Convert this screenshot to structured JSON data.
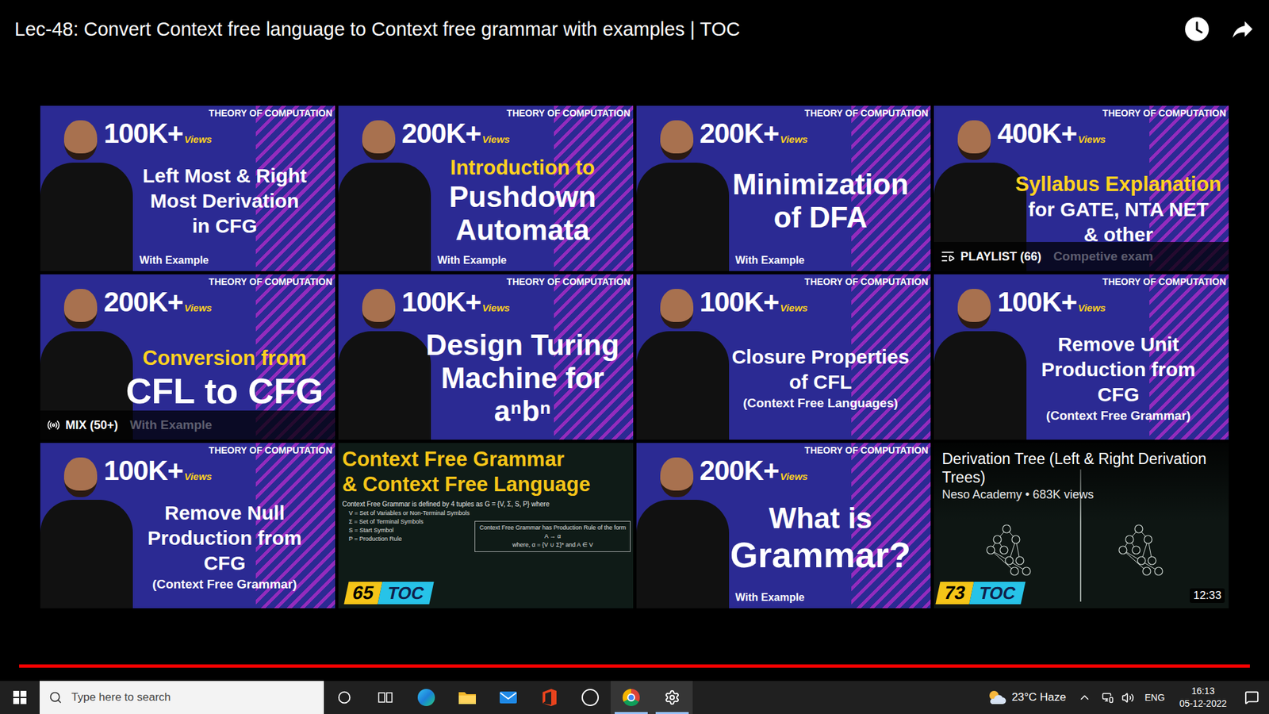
{
  "player": {
    "title": "Lec-48: Convert Context free language to Context free grammar with examples | TOC"
  },
  "progress": {
    "level": 1
  },
  "videos": [
    {
      "kind": "channel",
      "banner": "THEORY OF COMPUTATION",
      "views": "100K+",
      "views_label": "Views",
      "lines": [
        {
          "text": "Left Most & Right",
          "kind": "normal",
          "color": "#ffffff"
        },
        {
          "text": "Most Derivation",
          "kind": "normal",
          "color": "#ffffff"
        },
        {
          "text": "in CFG",
          "kind": "normal",
          "color": "#ffffff"
        }
      ],
      "footer": "With Example"
    },
    {
      "kind": "channel",
      "banner": "THEORY OF COMPUTATION",
      "views": "200K+",
      "views_label": "Views",
      "lines": [
        {
          "text": "Introduction to",
          "kind": "accent",
          "color": "#ffd21f"
        },
        {
          "text": "Pushdown",
          "kind": "big",
          "color": "#ffffff"
        },
        {
          "text": "Automata",
          "kind": "big",
          "color": "#ffffff"
        }
      ],
      "footer": "With Example"
    },
    {
      "kind": "channel",
      "banner": "THEORY OF COMPUTATION",
      "views": "200K+",
      "views_label": "Views",
      "lines": [
        {
          "text": "Minimization",
          "kind": "big",
          "color": "#ffffff"
        },
        {
          "text": "of DFA",
          "kind": "big",
          "color": "#ffffff"
        }
      ],
      "footer": "With Example"
    },
    {
      "kind": "channel",
      "banner": "THEORY OF COMPUTATION",
      "views": "400K+",
      "views_label": "Views",
      "lines": [
        {
          "text": "Syllabus Explanation",
          "kind": "accent",
          "color": "#ffd21f"
        },
        {
          "text": "for GATE, NTA NET",
          "kind": "normal",
          "color": "#ffffff"
        },
        {
          "text": "& other",
          "kind": "normal",
          "color": "#ffffff"
        }
      ],
      "overlay": {
        "kind": "playlist",
        "label": "PLAYLIST (66)",
        "faded": "Competive exam"
      }
    },
    {
      "kind": "channel",
      "banner": "THEORY OF COMPUTATION",
      "views": "200K+",
      "views_label": "Views",
      "lines": [
        {
          "text": "Conversion from",
          "kind": "accent",
          "color": "#ffd21f"
        },
        {
          "text": "CFL to CFG",
          "kind": "huge",
          "color": "#ffffff"
        }
      ],
      "overlay": {
        "kind": "mix",
        "label": "MIX (50+)",
        "faded": "With Example"
      }
    },
    {
      "kind": "channel",
      "banner": "THEORY OF COMPUTATION",
      "views": "100K+",
      "views_label": "Views",
      "lines": [
        {
          "text": "Design Turing",
          "kind": "big",
          "color": "#ffffff"
        },
        {
          "text": "Machine for",
          "kind": "big",
          "color": "#ffffff"
        },
        {
          "text": "aⁿbⁿ",
          "kind": "big",
          "color": "#ffffff"
        }
      ]
    },
    {
      "kind": "channel",
      "banner": "THEORY OF COMPUTATION",
      "views": "100K+",
      "views_label": "Views",
      "lines": [
        {
          "text": "Closure Properties",
          "kind": "normal",
          "color": "#ffffff"
        },
        {
          "text": "of CFL",
          "kind": "normal",
          "color": "#ffffff"
        },
        {
          "text": "(Context Free Languages)",
          "kind": "small",
          "color": "#ffffff"
        }
      ]
    },
    {
      "kind": "channel",
      "banner": "THEORY OF COMPUTATION",
      "views": "100K+",
      "views_label": "Views",
      "lines": [
        {
          "text": "Remove Unit",
          "kind": "normal",
          "color": "#ffffff"
        },
        {
          "text": "Production from",
          "kind": "normal",
          "color": "#ffffff"
        },
        {
          "text": "CFG",
          "kind": "normal",
          "color": "#ffffff"
        },
        {
          "text": "(Context Free Grammar)",
          "kind": "small",
          "color": "#ffffff"
        }
      ]
    },
    {
      "kind": "channel",
      "banner": "THEORY OF COMPUTATION",
      "views": "100K+",
      "views_label": "Views",
      "lines": [
        {
          "text": "Remove Null",
          "kind": "normal",
          "color": "#ffffff"
        },
        {
          "text": "Production from",
          "kind": "normal",
          "color": "#ffffff"
        },
        {
          "text": "CFG",
          "kind": "normal",
          "color": "#ffffff"
        },
        {
          "text": "(Context Free Grammar)",
          "kind": "small",
          "color": "#ffffff"
        }
      ]
    },
    {
      "kind": "neso",
      "heading": [
        "Context Free Grammar",
        "& Context Free Language"
      ],
      "intro": "Context Free Grammar is defined by 4 tuples as  G = {V, Σ, S, P}  where",
      "definition": [
        "V = Set of Variables or Non-Terminal Symbols",
        "Σ = Set of Terminal Symbols",
        "S = Start Symbol",
        "P = Production Rule"
      ],
      "box": [
        "Context Free Grammar has Production Rule of the form",
        "A → α",
        "where, α = {V ∪ Σ}*   and   A ∈ V"
      ],
      "badge": {
        "number": "65",
        "series": "TOC"
      }
    },
    {
      "kind": "channel",
      "banner": "THEORY OF COMPUTATION",
      "views": "200K+",
      "views_label": "Views",
      "lines": [
        {
          "text": "What is",
          "kind": "big",
          "color": "#ffffff"
        },
        {
          "text": "Grammar?",
          "kind": "huge",
          "color": "#ffffff"
        }
      ],
      "footer": "With Example"
    },
    {
      "kind": "neso-hover",
      "title": "Derivation Tree (Left & Right Derivation Trees)",
      "channel": "Neso Academy • 683K views",
      "duration": "12:33",
      "badge": {
        "number": "73",
        "series": "TOC"
      }
    }
  ],
  "taskbar": {
    "search": {
      "placeholder": "Type here to search"
    },
    "apps": [
      {
        "kind": "cortana",
        "running": false
      },
      {
        "kind": "task-view",
        "running": false
      },
      {
        "kind": "edge",
        "running": false
      },
      {
        "kind": "explorer",
        "running": false
      },
      {
        "kind": "mail",
        "running": false
      },
      {
        "kind": "office",
        "running": false
      },
      {
        "kind": "dell",
        "running": false
      },
      {
        "kind": "chrome",
        "running": true
      },
      {
        "kind": "settings",
        "running": true
      }
    ],
    "weather": "23°C Haze",
    "language": "ENG",
    "time": "16:13",
    "date": "05-12-2022"
  }
}
